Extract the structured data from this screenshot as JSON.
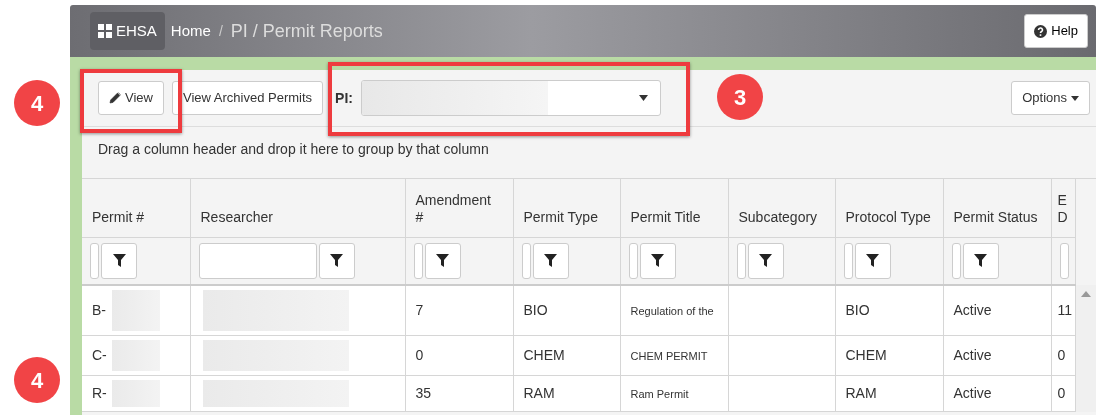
{
  "header": {
    "brand": "EHSA",
    "separator": "/",
    "breadcrumb": [
      {
        "label": "Home",
        "current": false
      },
      {
        "label": "PI / Permit Reports",
        "current": true
      }
    ],
    "help": "Help"
  },
  "toolbar": {
    "view": "View",
    "archived": "View Archived Permits",
    "pi_label": "PI:",
    "options": "Options"
  },
  "group_hint": "Drag a column header and drop it here to group by that column",
  "table": {
    "columns": [
      {
        "label": "Permit #",
        "kind": "compact"
      },
      {
        "label": "Researcher",
        "kind": "text"
      },
      {
        "label": "Amendment #",
        "kind": "compact"
      },
      {
        "label": "Permit Type",
        "kind": "compact"
      },
      {
        "label": "Permit Title",
        "kind": "title"
      },
      {
        "label": "Subcategory",
        "kind": "compact"
      },
      {
        "label": "Protocol Type",
        "kind": "compact"
      },
      {
        "label": "Permit Status",
        "kind": "compact"
      },
      {
        "label": "E D",
        "kind": "cut"
      }
    ],
    "rows": [
      {
        "cells": [
          "B-",
          "",
          "7",
          "BIO",
          "Regulation of the",
          "",
          "BIO",
          "Active",
          "11"
        ]
      },
      {
        "cells": [
          "C-",
          "",
          "0",
          "CHEM",
          "CHEM PERMIT",
          "",
          "CHEM",
          "Active",
          "0"
        ]
      },
      {
        "cells": [
          "R-",
          "",
          "35",
          "RAM",
          "Ram Permit",
          "",
          "RAM",
          "Active",
          "0"
        ]
      }
    ]
  },
  "callouts": [
    "4",
    "3",
    "4"
  ]
}
